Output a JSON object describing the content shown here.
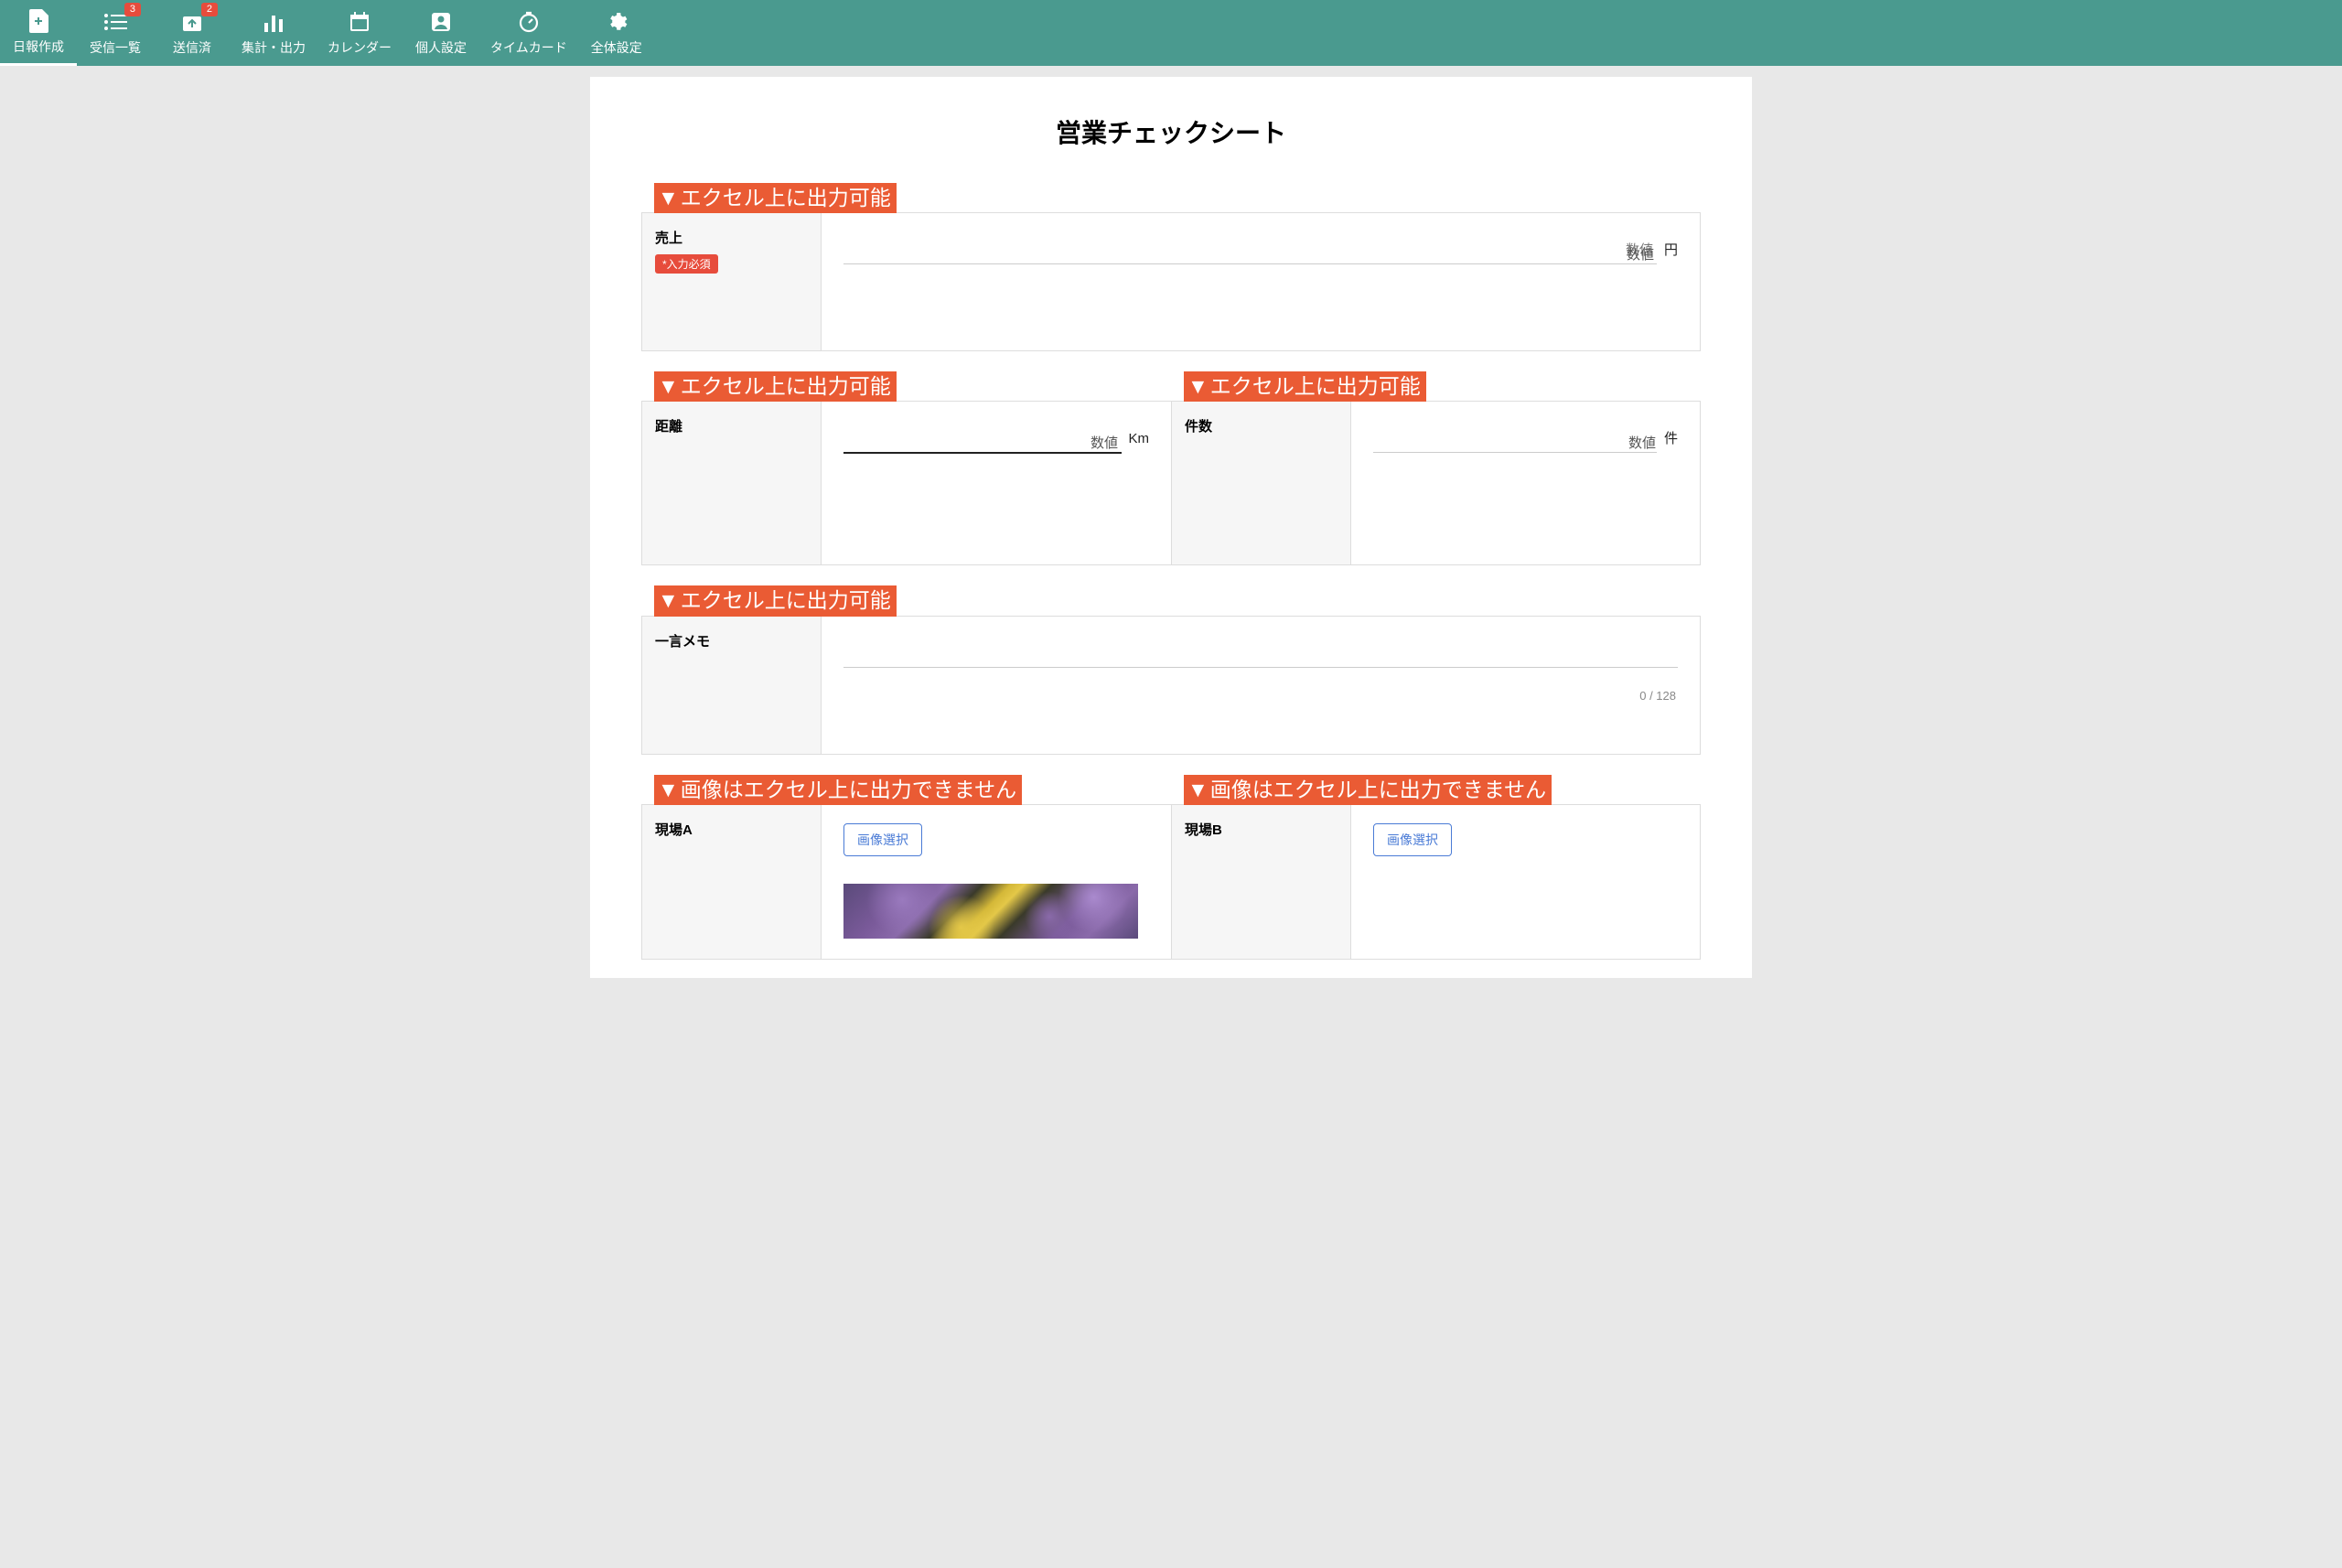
{
  "nav": {
    "items": [
      {
        "label": "日報作成",
        "icon": "file-plus",
        "active": true,
        "badge": null
      },
      {
        "label": "受信一覧",
        "icon": "list",
        "active": false,
        "badge": "3"
      },
      {
        "label": "送信済",
        "icon": "send-archive",
        "active": false,
        "badge": "2"
      },
      {
        "label": "集計・出力",
        "icon": "bar-chart",
        "active": false,
        "badge": null
      },
      {
        "label": "カレンダー",
        "icon": "calendar",
        "active": false,
        "badge": null
      },
      {
        "label": "個人設定",
        "icon": "account",
        "active": false,
        "badge": null
      },
      {
        "label": "タイムカード",
        "icon": "timer",
        "active": false,
        "badge": null
      },
      {
        "label": "全体設定",
        "icon": "gear",
        "active": false,
        "badge": null
      }
    ]
  },
  "page": {
    "title": "営業チェックシート"
  },
  "annotations": {
    "excel_output_ok": "エクセル上に出力可能",
    "excel_image_ng": "画像はエクセル上に出力できません"
  },
  "fields": {
    "sales": {
      "label": "売上",
      "required_badge": "*入力必須",
      "hint": "数値",
      "unit": "円"
    },
    "distance": {
      "label": "距離",
      "hint": "数値",
      "unit": "Km"
    },
    "count": {
      "label": "件数",
      "hint": "数値",
      "unit": "件"
    },
    "memo": {
      "label": "一言メモ",
      "char_count": "0 / 128"
    },
    "site_a": {
      "label": "現場A",
      "button": "画像選択"
    },
    "site_b": {
      "label": "現場B",
      "button": "画像選択"
    }
  }
}
